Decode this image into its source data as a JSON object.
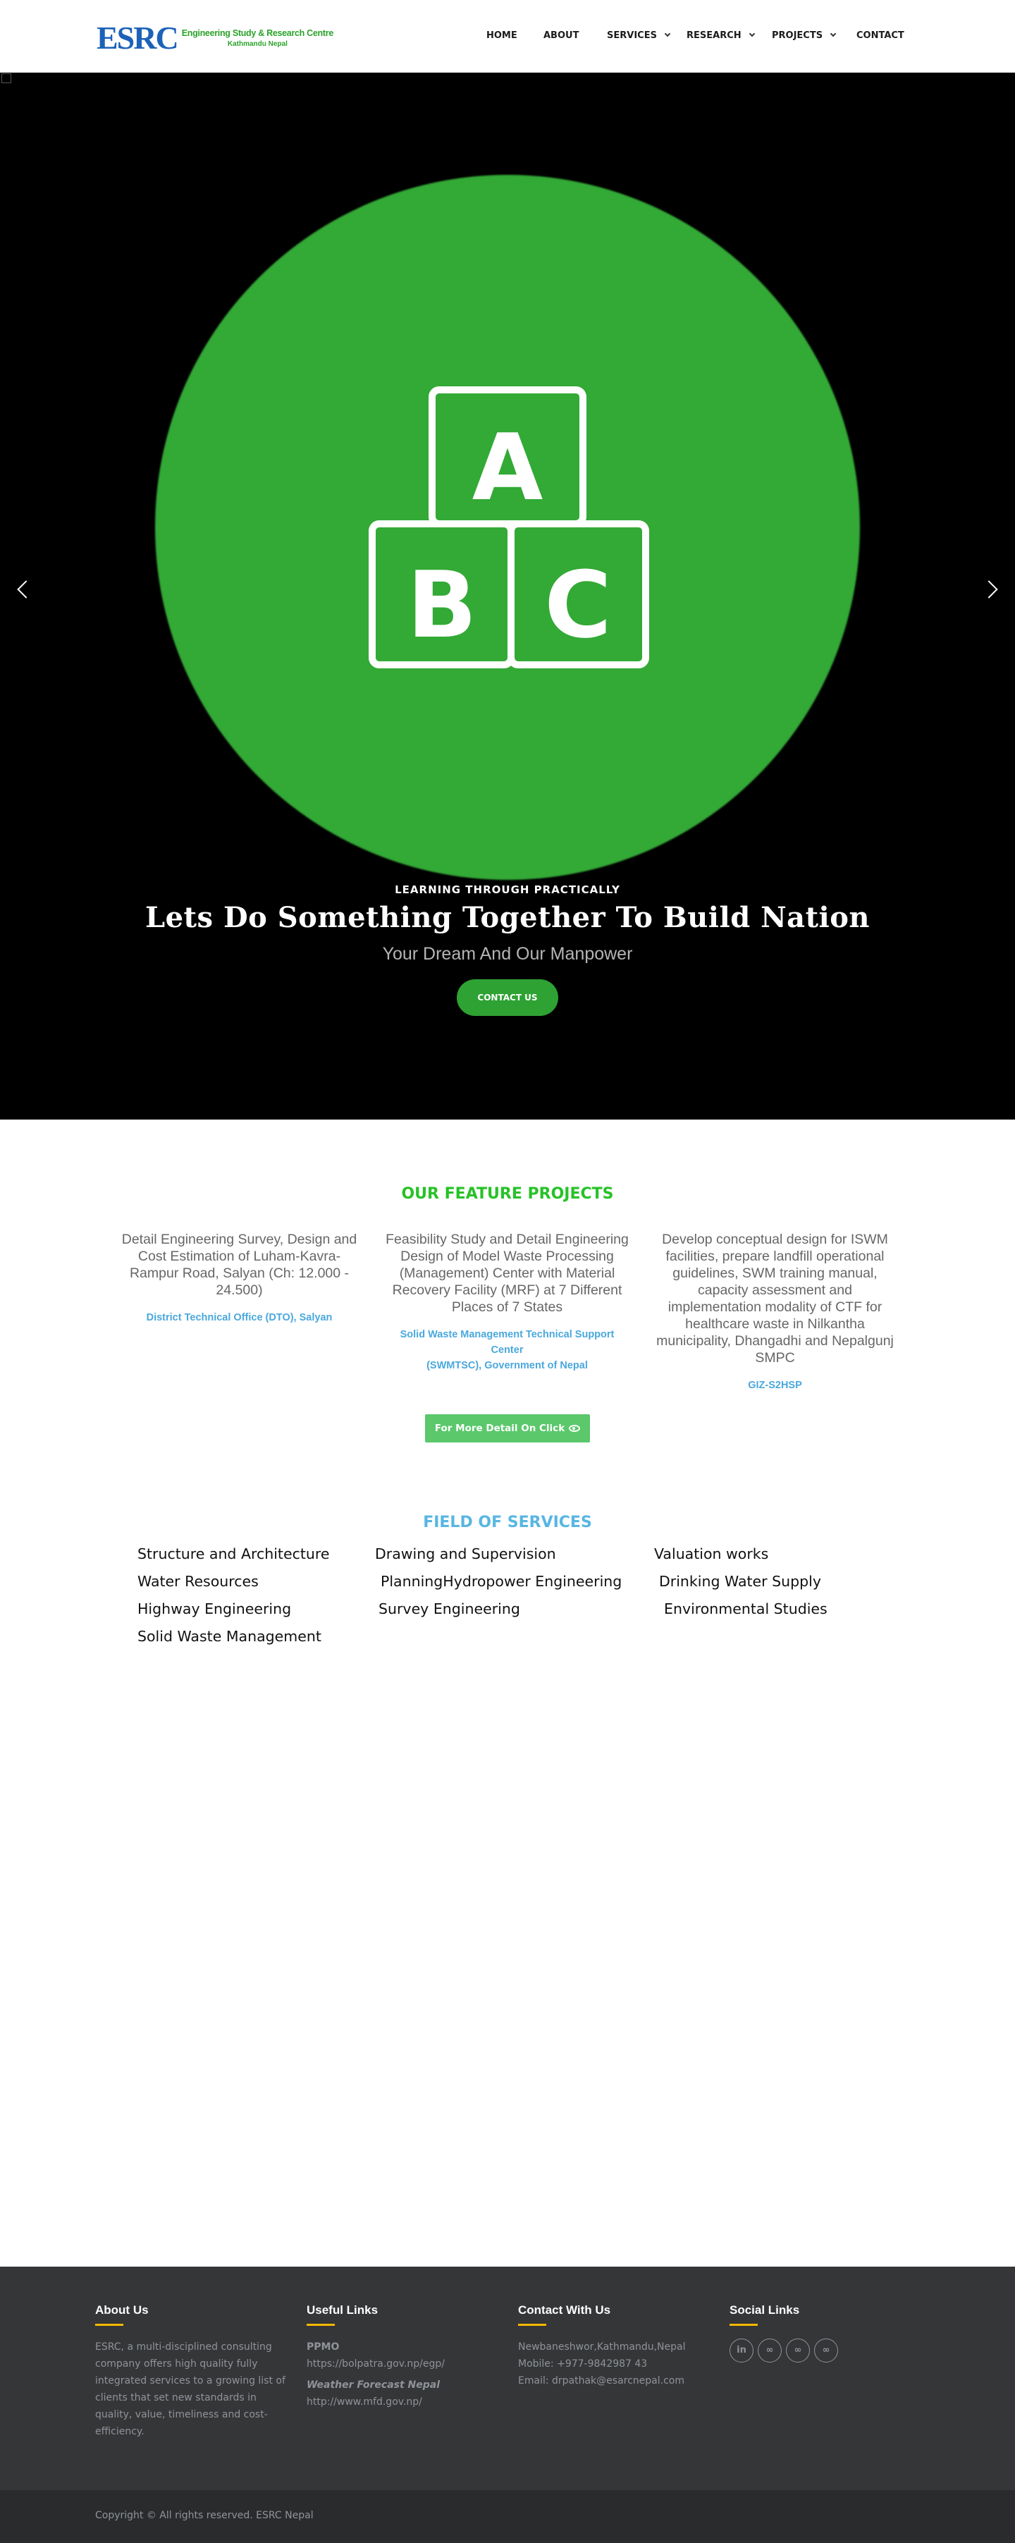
{
  "header": {
    "logo_mark": "ESRC",
    "logo_line1": "Engineering Study & Research Centre",
    "logo_line2": "Kathmandu Nepal",
    "nav": [
      {
        "label": "HOME"
      },
      {
        "label": "ABOUT"
      },
      {
        "label": "SERVICES"
      },
      {
        "label": "RESEARCH"
      },
      {
        "label": "PROJECTS"
      },
      {
        "label": "CONTACT"
      }
    ]
  },
  "hero": {
    "image_text": [
      "A",
      "B",
      "C"
    ],
    "tagline": "LEARNING THROUGH PRACTICALLY",
    "title": "Lets Do Something Together To Build Nation",
    "subtitle": "Your Dream And Our Manpower",
    "button": "CONTACT US",
    "colors": {
      "background": "#000000",
      "circle": "#33a936",
      "button": "#2ea233"
    }
  },
  "features": {
    "title": "OUR FEATURE PROJECTS",
    "projects": [
      {
        "desc_lines": [
          "Detail Engineering Survey, Design and",
          "Cost Estimation of Luham-Kavra-",
          "Rampur Road, Salyan (Ch: 12.000 -",
          "24.500)"
        ],
        "client_lines": [
          "District Technical Office (DTO), Salyan"
        ]
      },
      {
        "desc_lines": [
          "Feasibility Study and Detail Engineering",
          "Design of Model Waste Processing",
          "(Management) Center with Material",
          "Recovery Facility (MRF) at 7 Different",
          "Places of 7 States"
        ],
        "client_lines": [
          "Solid Waste Management Technical Support Center",
          "(SWMTSC), Government of Nepal"
        ]
      },
      {
        "desc_lines": [
          "Develop conceptual design for ISWM",
          "facilities, prepare landfill operational",
          "guidelines, SWM training manual,",
          "capacity assessment and",
          "implementation modality of CTF for",
          "healthcare waste in Nilkantha",
          "municipality, Dhangadhi and Nepalgunj",
          "SMPC"
        ],
        "client_lines": [
          "GIZ-S2HSP"
        ]
      }
    ],
    "more_button": "For More Detail On Click"
  },
  "services": {
    "title": "FIELD OF SERVICES",
    "items": [
      "Structure and Architecture",
      "Drawing and Supervision",
      "Valuation works",
      "Water Resources",
      "PlanningHydropower Engineering",
      "Drinking Water Supply",
      "Highway Engineering",
      "Survey Engineering",
      "Environmental Studies",
      "Solid Waste Management"
    ]
  },
  "footer": {
    "about": {
      "heading": "About Us",
      "lines": [
        "ESRC,  a multi-disciplined consulting",
        "company offers  high quality fully",
        "integrated services to a growing list of",
        "clients that set new standards in",
        "quality, value, timeliness and cost-",
        "efficiency."
      ]
    },
    "links": {
      "heading": "Useful Links",
      "ppmo_title": "PPMO",
      "ppmo_url": "https://bolpatra.gov.np/egp/",
      "weather_title": "Weather Forecast Nepal",
      "weather_url": "http://www.mfd.gov.np/"
    },
    "contact": {
      "heading": "Contact With Us",
      "address": "Newbaneshwor,Kathmandu,Nepal",
      "mobile": "Mobile: +977-9842987 43",
      "email": "Email: drpathak@esarcnepal.com"
    },
    "social": {
      "heading": "Social Links",
      "icons": [
        "linkedin-icon",
        "link-icon",
        "link-icon",
        "link-icon"
      ]
    },
    "copyright": "Copyright © All rights reserved. ESRC Nepal",
    "colors": {
      "accent": "#f5b800",
      "background": "#353638"
    }
  }
}
